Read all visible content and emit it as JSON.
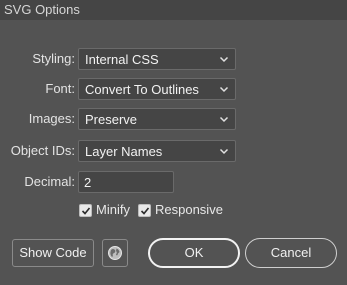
{
  "window": {
    "title": "SVG Options"
  },
  "fields": {
    "styling": {
      "label": "Styling:",
      "value": "Internal CSS"
    },
    "font": {
      "label": "Font:",
      "value": "Convert To Outlines"
    },
    "images": {
      "label": "Images:",
      "value": "Preserve"
    },
    "object_ids": {
      "label": "Object IDs:",
      "value": "Layer Names"
    },
    "decimal": {
      "label": "Decimal:",
      "value": "2"
    }
  },
  "checkboxes": {
    "minify": {
      "label": "Minify",
      "checked": true
    },
    "responsive": {
      "label": "Responsive",
      "checked": true
    }
  },
  "buttons": {
    "show_code": "Show Code",
    "web_preview_icon": "globe-icon",
    "ok": "OK",
    "cancel": "Cancel"
  }
}
